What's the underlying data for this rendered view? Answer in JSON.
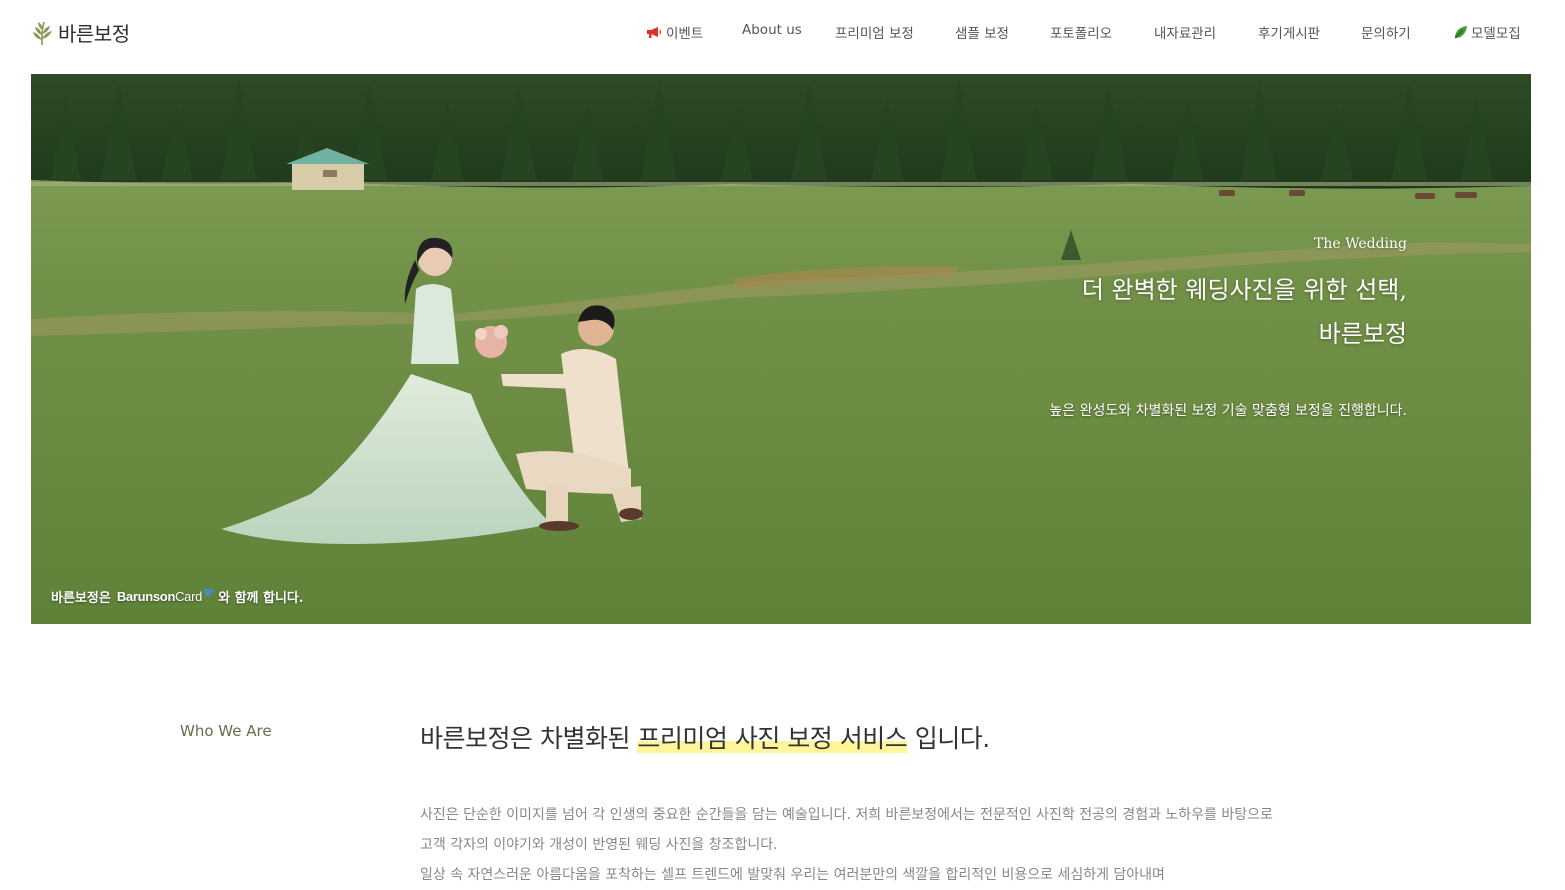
{
  "header": {
    "logo_text": "바른보정",
    "nav": [
      {
        "label": "이벤트",
        "icon": "megaphone-icon"
      },
      {
        "label": "About us"
      },
      {
        "label": "프리미엄 보정"
      },
      {
        "label": "샘플 보정"
      },
      {
        "label": "포토폴리오"
      },
      {
        "label": "내자료관리"
      },
      {
        "label": "후기게시판"
      },
      {
        "label": "문의하기"
      },
      {
        "label": "모델모집",
        "icon": "leaf-icon"
      }
    ]
  },
  "hero": {
    "eyebrow": "The Wedding",
    "title_line1": "더 완벽한 웨딩사진을 위한 선택,",
    "title_line2": "바른보정",
    "description": "높은 완성도와 차별화된 보정 기술 맞춤형 보정을 진행합니다.",
    "partner_prefix": "바른보정은",
    "partner_brand": "Barunson",
    "partner_brand_sub": "Card",
    "partner_suffix": "와 함께 합니다."
  },
  "about": {
    "section_label": "Who We Are",
    "title_before": "바른보정은 차별화된",
    "title_highlight": "프리미엄 사진 보정 서비스",
    "title_after": "입니다.",
    "paragraph_lines": [
      "사진은 단순한 이미지를 넘어 각 인생의 중요한 순간들을 담는 예술입니다. 저희 바른보정에서는 전문적인 사진학 전공의 경험과 노하우를 바탕으로",
      "고객 각자의 이야기와 개성이 반영된 웨딩 사진을 창조합니다.",
      "일상 속 자연스러운 아름다움을 포착하는 셀프 트렌드에 발맞춰 우리는 여러분만의 색깔을 합리적인 비용으로 세심하게 담아내며"
    ]
  },
  "colors": {
    "highlight": "#fff59a",
    "label_olive": "#6b6b4b",
    "grass": "#6e8f45"
  }
}
